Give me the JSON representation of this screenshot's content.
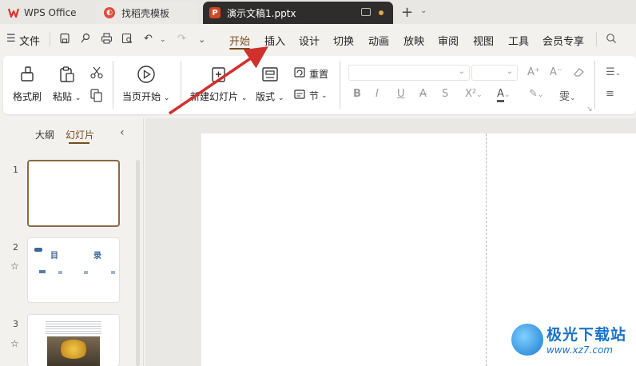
{
  "tabs": {
    "wps": "WPS Office",
    "template": "找稻壳模板",
    "document": "演示文稿1.pptx"
  },
  "menu": {
    "file": "文件",
    "items": [
      "开始",
      "插入",
      "设计",
      "切换",
      "动画",
      "放映",
      "审阅",
      "视图",
      "工具",
      "会员专享"
    ]
  },
  "ribbon": {
    "format_painter": "格式刷",
    "paste": "粘贴",
    "play_from_current": "当页开始",
    "new_slide": "新建幻灯片",
    "layout": "版式",
    "reset": "重置",
    "section": "节"
  },
  "panel": {
    "outline": "大纲",
    "slides": "幻灯片",
    "slide_numbers": [
      "1",
      "2",
      "3"
    ],
    "thumb2": {
      "title_left": "目",
      "title_right": "录"
    }
  },
  "watermark": {
    "name": "极光下载站",
    "url": "www.xz7.com"
  },
  "colors": {
    "accent": "#7a4b1f",
    "active_tab": "#2f2d2b",
    "arrow": "#d0312d"
  }
}
